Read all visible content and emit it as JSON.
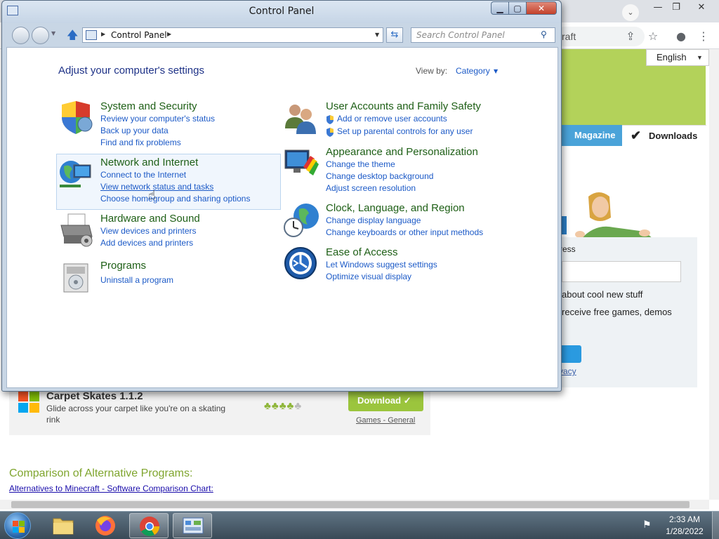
{
  "browser": {
    "address_partial": "raft",
    "language": "English",
    "tabs": {
      "magazine": "Magazine",
      "downloads": "Downloads"
    },
    "newsletter": {
      "label_partial": "ress",
      "line1": "about cool new stuff",
      "line2": "receive free games, demos",
      "privacy_partial": "vacy"
    },
    "program": {
      "title": "Carpet Skates 1.1.2",
      "description": "Glide across your carpet like you're on a skating rink",
      "rating": 4,
      "download_label": "Download",
      "category_link": "Games - General"
    },
    "comparison": {
      "title": "Comparison of Alternative Programs:",
      "link": "Alternatives to Minecraft - Software Comparison Chart:"
    }
  },
  "control_panel": {
    "window_title": "Control Panel",
    "address": "Control Panel",
    "search_placeholder": "Search Control Panel",
    "heading": "Adjust your computer's settings",
    "view_by_label": "View by:",
    "view_by_value": "Category",
    "categories": [
      {
        "title": "System and Security",
        "icon": "shield-icon",
        "links": [
          "Review your computer's status",
          "Back up your data",
          "Find and fix problems"
        ]
      },
      {
        "title": "Network and Internet",
        "icon": "globe-network-icon",
        "links": [
          "Connect to the Internet",
          "View network status and tasks",
          "Choose homegroup and sharing options"
        ]
      },
      {
        "title": "Hardware and Sound",
        "icon": "printer-icon",
        "links": [
          "View devices and printers",
          "Add devices and printers"
        ]
      },
      {
        "title": "Programs",
        "icon": "programs-icon",
        "links": [
          "Uninstall a program"
        ]
      },
      {
        "title": "User Accounts and Family Safety",
        "icon": "users-icon",
        "links": [
          "Add or remove user accounts",
          "Set up parental controls for any user"
        ]
      },
      {
        "title": "Appearance and Personalization",
        "icon": "monitor-palette-icon",
        "links": [
          "Change the theme",
          "Change desktop background",
          "Adjust screen resolution"
        ]
      },
      {
        "title": "Clock, Language, and Region",
        "icon": "clock-globe-icon",
        "links": [
          "Change display language",
          "Change keyboards or other input methods"
        ]
      },
      {
        "title": "Ease of Access",
        "icon": "ease-of-access-icon",
        "links": [
          "Let Windows suggest settings",
          "Optimize visual display"
        ]
      }
    ]
  },
  "taskbar": {
    "time": "2:33 AM",
    "date": "1/28/2022"
  }
}
